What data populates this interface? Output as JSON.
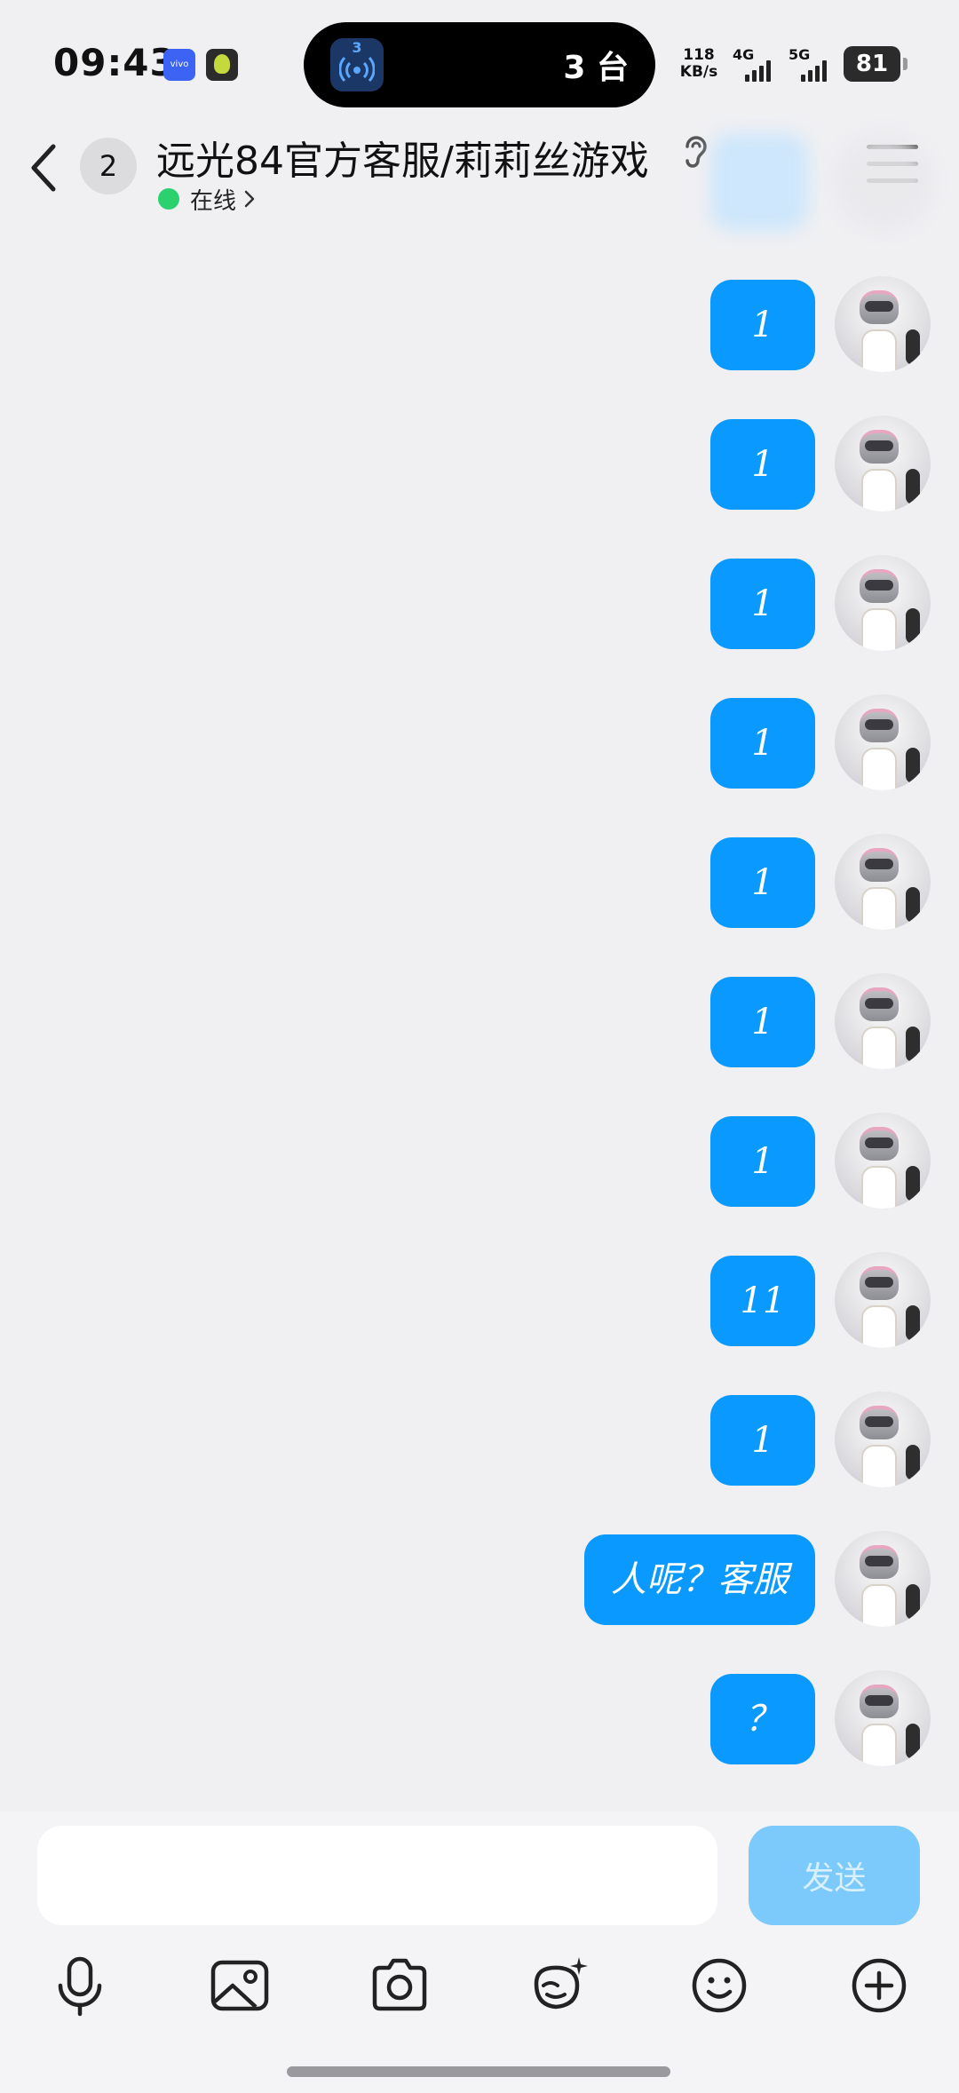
{
  "status_bar": {
    "time": "09:43",
    "badge_vivo": "vivo",
    "island_count": "3",
    "island_text": "3 台",
    "net_speed": "118",
    "net_unit": "KB/s",
    "signal_1": "4G",
    "signal_2": "5G",
    "battery": "81"
  },
  "header": {
    "unread": "2",
    "title": "远光84官方客服/莉莉丝游戏",
    "status": "在线"
  },
  "messages": [
    {
      "text": "1"
    },
    {
      "text": "1"
    },
    {
      "text": "1"
    },
    {
      "text": "1"
    },
    {
      "text": "1"
    },
    {
      "text": "1"
    },
    {
      "text": "1"
    },
    {
      "text": "11"
    },
    {
      "text": "1"
    },
    {
      "text": "人呢？客服"
    },
    {
      "text": "？"
    }
  ],
  "input": {
    "value": "",
    "send_label": "发送"
  },
  "colors": {
    "bubble": "#0a99ff",
    "send_disabled": "#7cc9fb",
    "online": "#2bd16e",
    "background": "#f0f0f3"
  },
  "toolbar_icons": [
    "microphone-icon",
    "image-icon",
    "camera-icon",
    "sticker-icon",
    "emoji-icon",
    "plus-icon"
  ]
}
